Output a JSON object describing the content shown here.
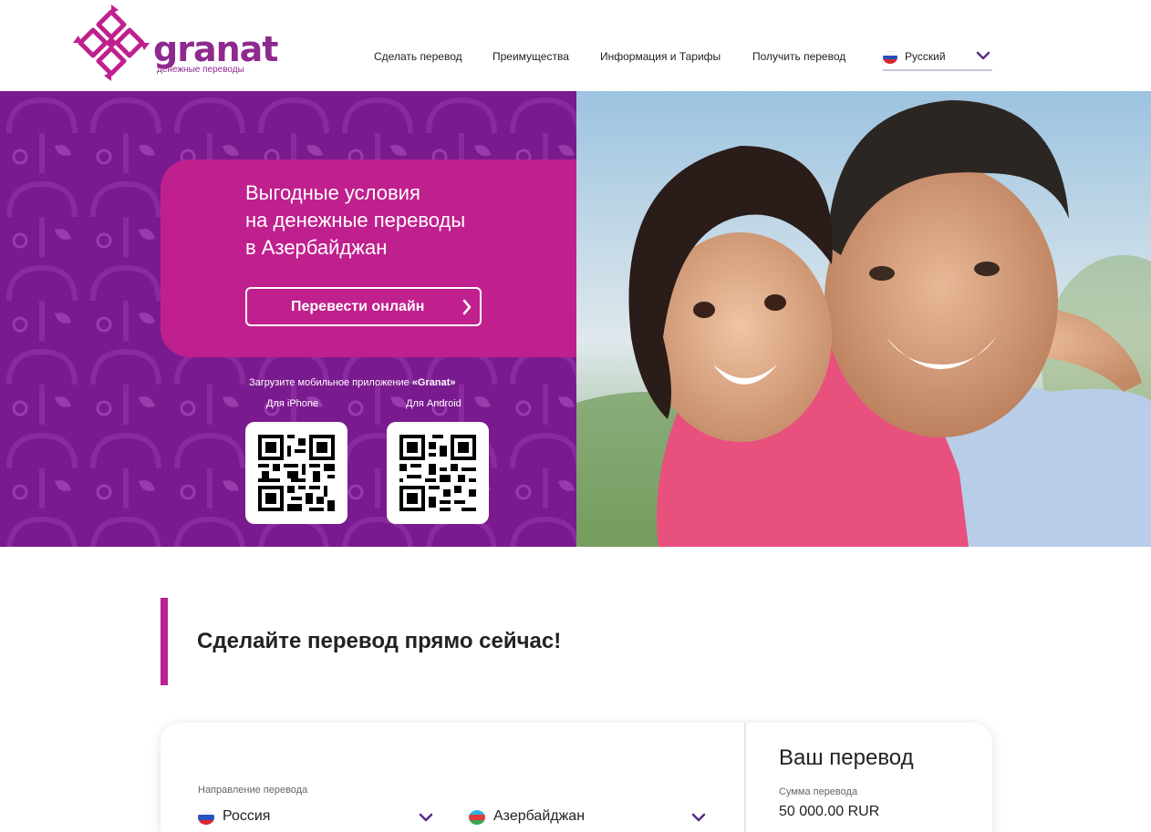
{
  "brand": {
    "name": "granat",
    "tagline": "денежные переводы",
    "color": "#8e2a8f"
  },
  "nav": {
    "items": [
      {
        "label": "Сделать перевод"
      },
      {
        "label": "Преимущества"
      },
      {
        "label": "Информация и Тарифы"
      },
      {
        "label": "Получить перевод"
      }
    ],
    "language": {
      "label": "Русский",
      "flag": "flag-ru-icon"
    }
  },
  "hero": {
    "title_lines": [
      "Выгодные условия",
      "на денежные переводы",
      "в Азербайджан"
    ],
    "cta_label": "Перевести онлайн",
    "app_prefix": "Загрузите мобильное приложение ",
    "app_name": "«Granat»",
    "iphone_label": "Для iPhone",
    "android_label": "Для Android",
    "bg_color": "#7a1a8f",
    "card_color": "#c0208e"
  },
  "section": {
    "title": "Сделайте перевод прямо сейчас!",
    "accent": "#b8238f"
  },
  "form": {
    "direction_label": "Направление перевода",
    "from": {
      "label": "Россия",
      "flag": "flag-ru-icon"
    },
    "to": {
      "label": "Азербайджан",
      "flag": "flag-az-icon"
    }
  },
  "summary": {
    "title": "Ваш перевод",
    "amount_label": "Сумма перевода",
    "amount_value": "50 000.00 RUR"
  }
}
